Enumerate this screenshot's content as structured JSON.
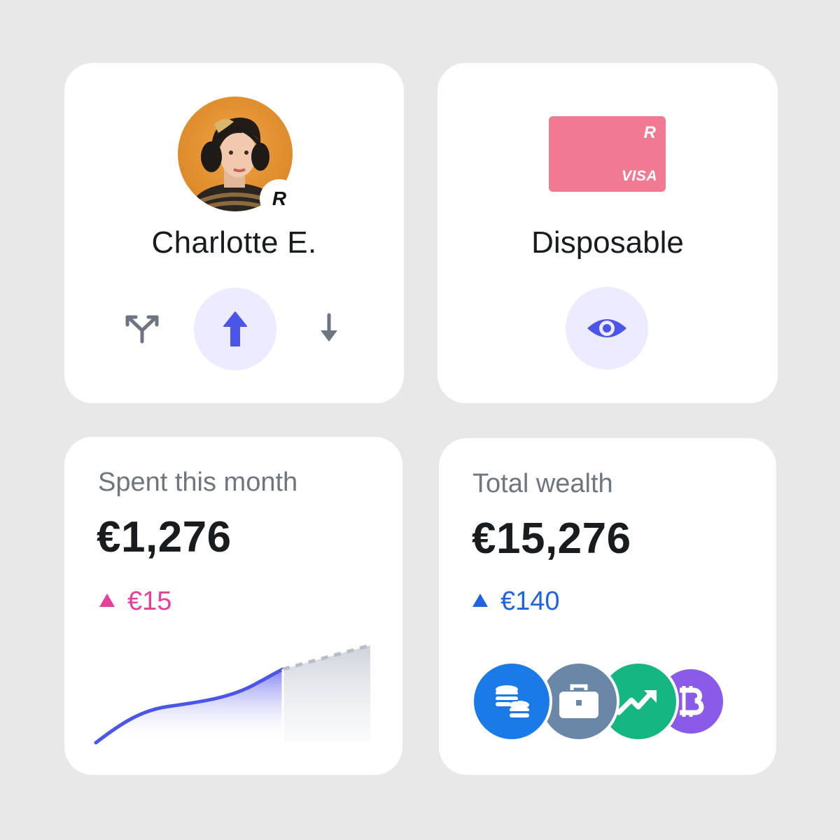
{
  "profile": {
    "name": "Charlotte E.",
    "badge": "R",
    "actions": [
      {
        "icon": "split-arrows-icon"
      },
      {
        "icon": "arrow-up-icon",
        "highlighted": true
      },
      {
        "icon": "arrow-down-icon"
      }
    ]
  },
  "card": {
    "label": "Disposable",
    "logo": "R",
    "network": "VISA",
    "color": "#f07a92",
    "action_icon": "eye-icon"
  },
  "spent": {
    "label": "Spent this month",
    "value": "€1,276",
    "delta": "€15",
    "delta_direction": "up",
    "delta_color": "#e6409a",
    "chart_data": {
      "type": "area",
      "spent_fraction": 0.68,
      "series": [
        {
          "values": [
            0,
            0.21,
            0.33,
            0.38,
            0.46,
            0.68
          ]
        },
        {
          "values": [
            0.68,
            0.71,
            0.74,
            0.76,
            0.79
          ],
          "style": "dashed"
        }
      ]
    }
  },
  "wealth": {
    "label": "Total wealth",
    "value": "€15,276",
    "delta": "€140",
    "delta_direction": "up",
    "delta_color": "#1f63e0",
    "assets": [
      {
        "icon": "coins-icon",
        "color": "#1a7be8"
      },
      {
        "icon": "briefcase-icon",
        "color": "#6a87a8"
      },
      {
        "icon": "trend-up-icon",
        "color": "#16b682"
      },
      {
        "icon": "bitcoin-icon",
        "color": "#8a5be8"
      }
    ]
  }
}
